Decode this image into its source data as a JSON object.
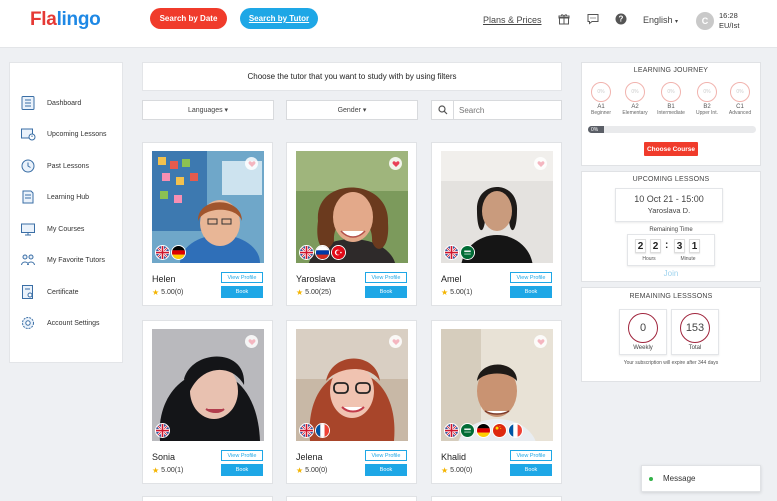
{
  "header": {
    "logo_a": "Fla",
    "logo_b": "lingo",
    "search_by_date": "Search by Date",
    "search_by_tutor": "Search by Tutor",
    "plans": "Plans & Prices",
    "language": "English",
    "avatar_letter": "C",
    "time": "16:28",
    "timezone": "EU/Ist"
  },
  "sidebar": {
    "items": [
      {
        "label": "Dashboard",
        "icon": "dashboard-icon"
      },
      {
        "label": "Upcoming Lessons",
        "icon": "upcoming-lessons-icon"
      },
      {
        "label": "Past Lessons",
        "icon": "past-lessons-icon"
      },
      {
        "label": "Learning Hub",
        "icon": "learning-hub-icon"
      },
      {
        "label": "My Courses",
        "icon": "my-courses-icon"
      },
      {
        "label": "My Favorite Tutors",
        "icon": "favorite-tutors-icon"
      },
      {
        "label": "Certificate",
        "icon": "certificate-icon"
      },
      {
        "label": "Account Settings",
        "icon": "settings-icon"
      }
    ]
  },
  "filters": {
    "instruction": "Choose the tutor that you want to study with by using filters",
    "languages": "Languages",
    "gender": "Gender",
    "search_placeholder": "Search"
  },
  "tutor_buttons": {
    "view": "View Profile",
    "book": "Book"
  },
  "tutors": [
    {
      "name": "Helen",
      "rating": "5.00(0)",
      "flags": [
        "uk",
        "de"
      ],
      "favorited": false
    },
    {
      "name": "Yaroslava",
      "rating": "5.00(25)",
      "flags": [
        "uk",
        "ru",
        "tr"
      ],
      "favorited": true
    },
    {
      "name": "Amel",
      "rating": "5.00(1)",
      "flags": [
        "uk",
        "sa"
      ],
      "favorited": false
    },
    {
      "name": "Sonia",
      "rating": "5.00(1)",
      "flags": [
        "uk"
      ],
      "favorited": false
    },
    {
      "name": "Jelena",
      "rating": "5.00(0)",
      "flags": [
        "uk",
        "fr"
      ],
      "favorited": false
    },
    {
      "name": "Khalid",
      "rating": "5.00(0)",
      "flags": [
        "uk",
        "sa",
        "de",
        "cn",
        "fr"
      ],
      "favorited": false
    }
  ],
  "journey": {
    "title": "LEARNING JOURNEY",
    "levels": [
      {
        "pct": "0%",
        "code": "A1",
        "name": "Beginner"
      },
      {
        "pct": "0%",
        "code": "A2",
        "name": "Elementary"
      },
      {
        "pct": "0%",
        "code": "B1",
        "name": "Intermediate"
      },
      {
        "pct": "0%",
        "code": "B2",
        "name": "Upper Int."
      },
      {
        "pct": "0%",
        "code": "C1",
        "name": "Advanced"
      }
    ],
    "progress_label": "0%",
    "progress": 0.0,
    "choose_course": "Choose Course"
  },
  "upcoming": {
    "title": "UPCOMING LESSONS",
    "datetime": "10 Oct 21 - 15:00",
    "tutor": "Yaroslava D.",
    "remaining_label": "Remaining Time",
    "digits": [
      "2",
      "2",
      "3",
      "1"
    ],
    "hours_label": "Hours",
    "minute_label": "Minute",
    "join": "Join"
  },
  "remaining": {
    "title": "REMAINING LESSSONS",
    "weekly_value": "0",
    "weekly_label": "Weekly",
    "total_value": "153",
    "total_label": "Total",
    "expire_text": "Your subscription will expire after 344 days"
  },
  "message": {
    "label": "Message"
  },
  "colors": {
    "brand_red": "#f03b2b",
    "brand_blue": "#1ea7e6",
    "online": "#33b249"
  }
}
